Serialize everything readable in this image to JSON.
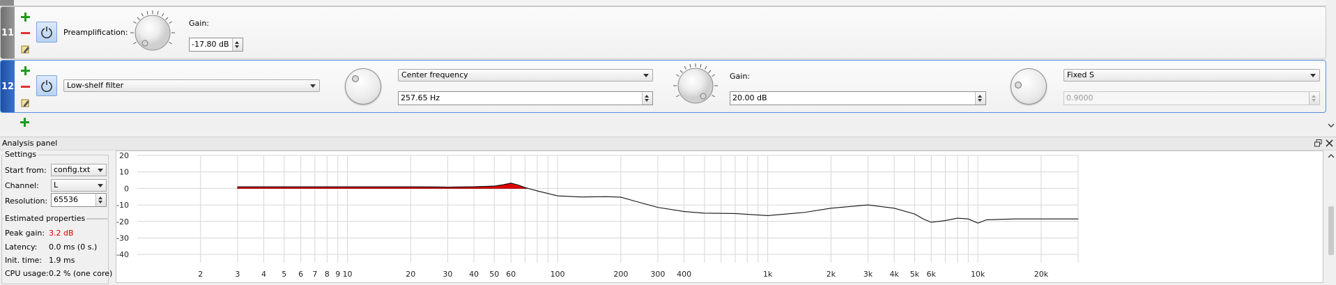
{
  "filters": [
    {
      "number": "11",
      "type_label": "Preamplification:",
      "gain_label": "Gain:",
      "gain_value": "-17.80 dB"
    },
    {
      "number": "12",
      "type_value": "Low-shelf filter",
      "freq_mode": "Center frequency",
      "freq_value": "257.65 Hz",
      "gain_label": "Gain:",
      "gain_value": "20.00 dB",
      "q_mode": "Fixed S",
      "q_value": "0.9000"
    }
  ],
  "analysis": {
    "title": "Analysis panel",
    "settings_title": "Settings",
    "start_from_label": "Start from:",
    "start_from_value": "config.txt",
    "channel_label": "Channel:",
    "channel_value": "L",
    "resolution_label": "Resolution:",
    "resolution_value": "65536",
    "estimated_title": "Estimated properties",
    "peak_gain_label": "Peak gain:",
    "peak_gain_value": "3.2 dB",
    "latency_label": "Latency:",
    "latency_value": "0.0 ms (0 s.)",
    "init_time_label": "Init. time:",
    "init_time_value": "1.9 ms",
    "cpu_label": "CPU usage:",
    "cpu_value": "0.2 % (one core)"
  },
  "colors": {
    "accent_blue": "#2a5db0",
    "peak_red": "#e00000",
    "add_green": "#1f9a1f",
    "remove_red": "#d33"
  },
  "chart_data": {
    "type": "line",
    "x_scale": "log",
    "xlim": [
      1,
      30000
    ],
    "ylim": [
      -45,
      20
    ],
    "grid": true,
    "x_ticks": [
      {
        "v": 2,
        "label": "2"
      },
      {
        "v": 3,
        "label": "3"
      },
      {
        "v": 4,
        "label": "4"
      },
      {
        "v": 5,
        "label": "5"
      },
      {
        "v": 6,
        "label": "6"
      },
      {
        "v": 7,
        "label": "7"
      },
      {
        "v": 8,
        "label": "8"
      },
      {
        "v": 9,
        "label": "9"
      },
      {
        "v": 10,
        "label": "10"
      },
      {
        "v": 20,
        "label": "20"
      },
      {
        "v": 30,
        "label": "30"
      },
      {
        "v": 40,
        "label": "40"
      },
      {
        "v": 50,
        "label": "50"
      },
      {
        "v": 60,
        "label": "60"
      },
      {
        "v": 100,
        "label": "100"
      },
      {
        "v": 200,
        "label": "200"
      },
      {
        "v": 300,
        "label": "300"
      },
      {
        "v": 400,
        "label": "400"
      },
      {
        "v": 1000,
        "label": "1k"
      },
      {
        "v": 2000,
        "label": "2k"
      },
      {
        "v": 3000,
        "label": "3k"
      },
      {
        "v": 4000,
        "label": "4k"
      },
      {
        "v": 5000,
        "label": "5k"
      },
      {
        "v": 6000,
        "label": "6k"
      },
      {
        "v": 10000,
        "label": "10k"
      },
      {
        "v": 20000,
        "label": "20k"
      }
    ],
    "y_ticks": [
      20,
      10,
      0,
      -10,
      -20,
      -30,
      -40
    ],
    "series": [
      {
        "x": [
          3,
          10,
          20,
          30,
          40,
          50,
          55,
          60,
          65,
          70,
          80,
          100,
          130,
          170,
          200,
          230,
          300,
          400,
          500,
          700,
          1000,
          1500,
          2000,
          3000,
          4000,
          5000,
          5500,
          6000,
          7000,
          8000,
          9000,
          10000,
          11000,
          15000,
          20000,
          30000
        ],
        "y": [
          1,
          1,
          1,
          0.8,
          1.0,
          1.4,
          2.2,
          3.2,
          2.0,
          0.5,
          -1.5,
          -4.5,
          -5.2,
          -5.0,
          -5.3,
          -7.5,
          -11.5,
          -14.0,
          -15.0,
          -15.2,
          -16.5,
          -14.5,
          -12.0,
          -10.0,
          -12.0,
          -15.5,
          -18.5,
          -20.5,
          -19.5,
          -18.0,
          -18.5,
          -21.0,
          -19.0,
          -18.5,
          -18.5,
          -18.5
        ]
      }
    ]
  }
}
